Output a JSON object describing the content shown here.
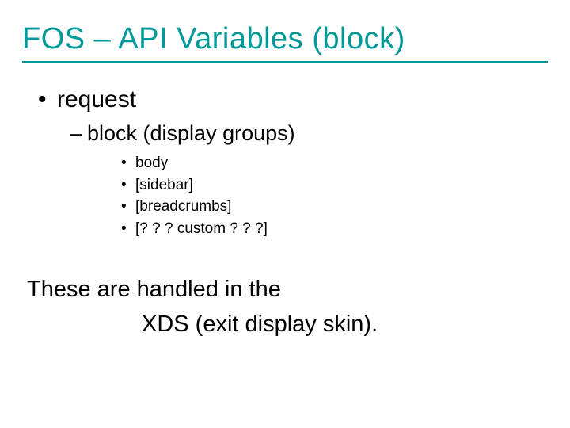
{
  "title": "FOS – API Variables (block)",
  "level1": {
    "bullet": "•",
    "text": "request"
  },
  "level2": {
    "dash": "–",
    "text": "block (display groups)"
  },
  "level3": {
    "bullet": "•",
    "items": [
      "body",
      "[sidebar]",
      "[breadcrumbs]",
      "[? ? ? custom ? ? ?]"
    ]
  },
  "footer": {
    "line1": "These are handled in the",
    "line2": "XDS (exit display skin)."
  }
}
